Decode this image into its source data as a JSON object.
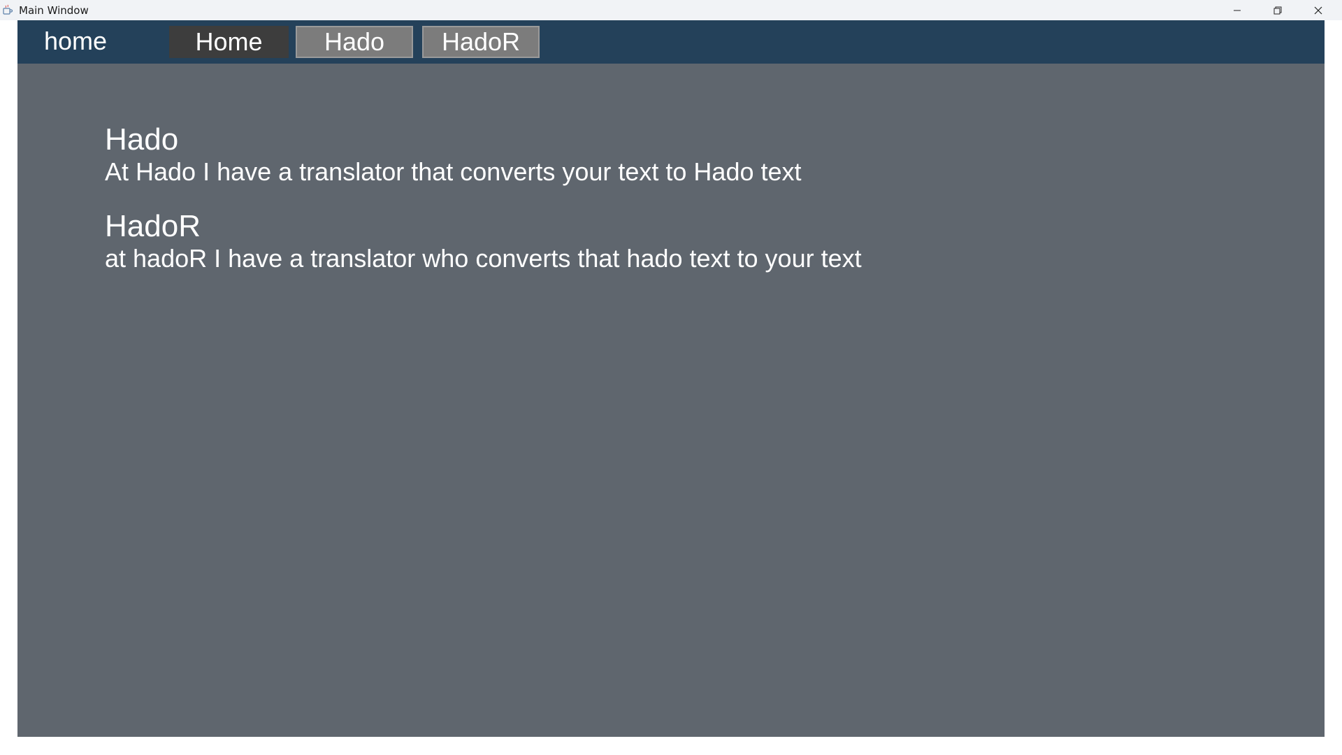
{
  "window": {
    "title": "Main Window",
    "app_icon": "java-cup-icon",
    "controls": {
      "minimize_icon": "minimize-icon",
      "maximize_icon": "restore-icon",
      "close_icon": "close-icon"
    }
  },
  "navbar": {
    "brand": "home",
    "buttons": [
      {
        "label": "Home"
      },
      {
        "label": "Hado"
      },
      {
        "label": "HadoR"
      }
    ]
  },
  "main": {
    "sections": [
      {
        "title": "Hado",
        "description": "At Hado I have a translator that converts your text to Hado text"
      },
      {
        "title": "HadoR",
        "description": "at hadoR I have a translator who converts that hado text to your text"
      }
    ]
  },
  "colors": {
    "navbar_bg": "#24415a",
    "content_bg": "#5f666e",
    "active_button_bg": "#3d3d3d",
    "button_bg": "#7c7c7c",
    "text": "#ffffff"
  }
}
